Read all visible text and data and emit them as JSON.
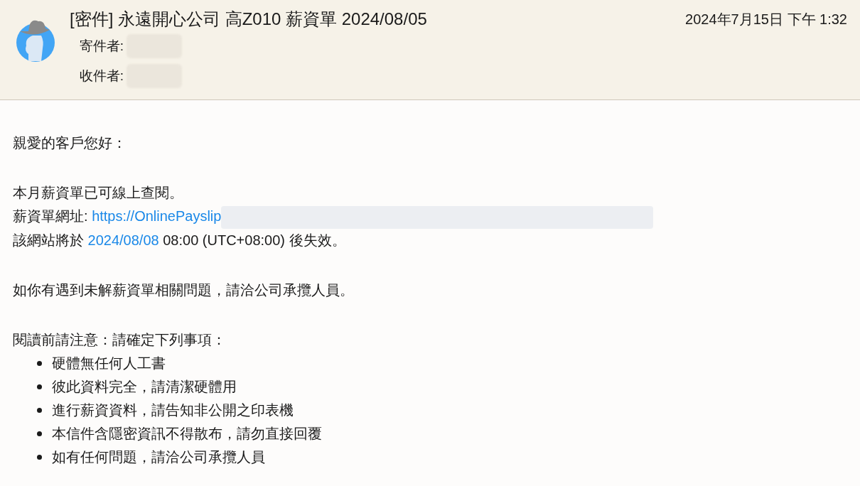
{
  "header": {
    "subject": "[密件] 永遠開心公司 高Z010 薪資單 2024/08/05",
    "date": "2024年7月15日 下午 1:32",
    "fields": [
      {
        "label": "寄件者:",
        "redacted": true
      },
      {
        "label": "收件者:",
        "redacted": true
      }
    ]
  },
  "body": {
    "paragraphs": [
      [
        {
          "kind": "text",
          "text": "親愛的客戶您好："
        }
      ],
      [
        {
          "kind": "text",
          "text": "本月薪資單已可線上查閱。"
        },
        {
          "kind": "link",
          "before": "薪資單網址: ",
          "link": "https://OnlinePayslip",
          "redacted": true
        },
        {
          "kind": "link",
          "before": "該網站將於 ",
          "link": "2024/08/08",
          "after": " 08:00 (UTC+08:00) 後失效。",
          "redacted": false
        }
      ],
      [
        {
          "kind": "text",
          "text": "如你有遇到未解薪資單相關問題，請洽公司承攬人員。"
        }
      ],
      [
        {
          "kind": "text",
          "text": "閱讀前請注意：請確定下列事項："
        }
      ]
    ],
    "bullets": [
      "硬體無任何人工書",
      "彼此資料完全，請清潔硬體用",
      "進行薪資資料，請告知非公開之印表機",
      "本信件含隱密資訊不得散布，請勿直接回覆",
      "如有任何問題，請洽公司承攬人員"
    ]
  }
}
